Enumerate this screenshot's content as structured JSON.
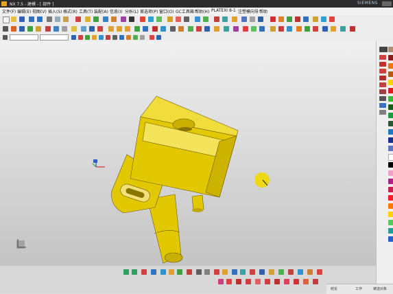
{
  "window": {
    "title": "NX 7.5 - 建模 - [ 部件 ]",
    "brand": "SIEMENS"
  },
  "menu": {
    "items": [
      "文件(F)",
      "编辑(E)",
      "视图(V)",
      "插入(S)",
      "格式(R)",
      "工具(T)",
      "装配(A)",
      "信息(I)",
      "分析(L)",
      "首选项(P)",
      "窗口(O)",
      "GC工具箱",
      "帮助(H)",
      "PLATEXI 8-1",
      "注塑模向导",
      "帮助"
    ]
  },
  "toolbar": {
    "selection_filter": "",
    "selection_scope": ""
  },
  "status": {
    "labels": [
      "结论",
      "工作",
      "被选对象"
    ]
  },
  "colors": {
    "model": "#e2c800",
    "viewport_top": "#f0f0f0",
    "viewport_bottom": "#c2c2c2",
    "palette": [
      "#b48c6e",
      "#8c1e1e",
      "#e67814",
      "#b45a1e",
      "#ffd200",
      "#dc1e1e",
      "#32be32",
      "#1e5a1e",
      "#14a03c",
      "#285a32",
      "#1e78c8",
      "#14328c",
      "#5a78c8",
      "#ffffff",
      "#000000",
      "#f0a0c8",
      "#b41e8c",
      "#c81e50",
      "#ff1e1e",
      "#ff7800",
      "#ffd200",
      "#5ac85a",
      "#1ea0a0",
      "#1e64c8"
    ]
  },
  "icons": [
    "new-file-icon",
    "open-icon",
    "save-icon",
    "undo-icon",
    "redo-icon",
    "cut-icon",
    "copy-icon",
    "paste-icon",
    "sketch-icon",
    "extrude-icon",
    "revolve-icon",
    "hole-icon",
    "blend-icon",
    "chamfer-icon",
    "shell-icon",
    "rotate-view-icon",
    "pan-icon",
    "zoom-icon",
    "fit-icon",
    "shaded-icon",
    "wireframe-icon"
  ]
}
